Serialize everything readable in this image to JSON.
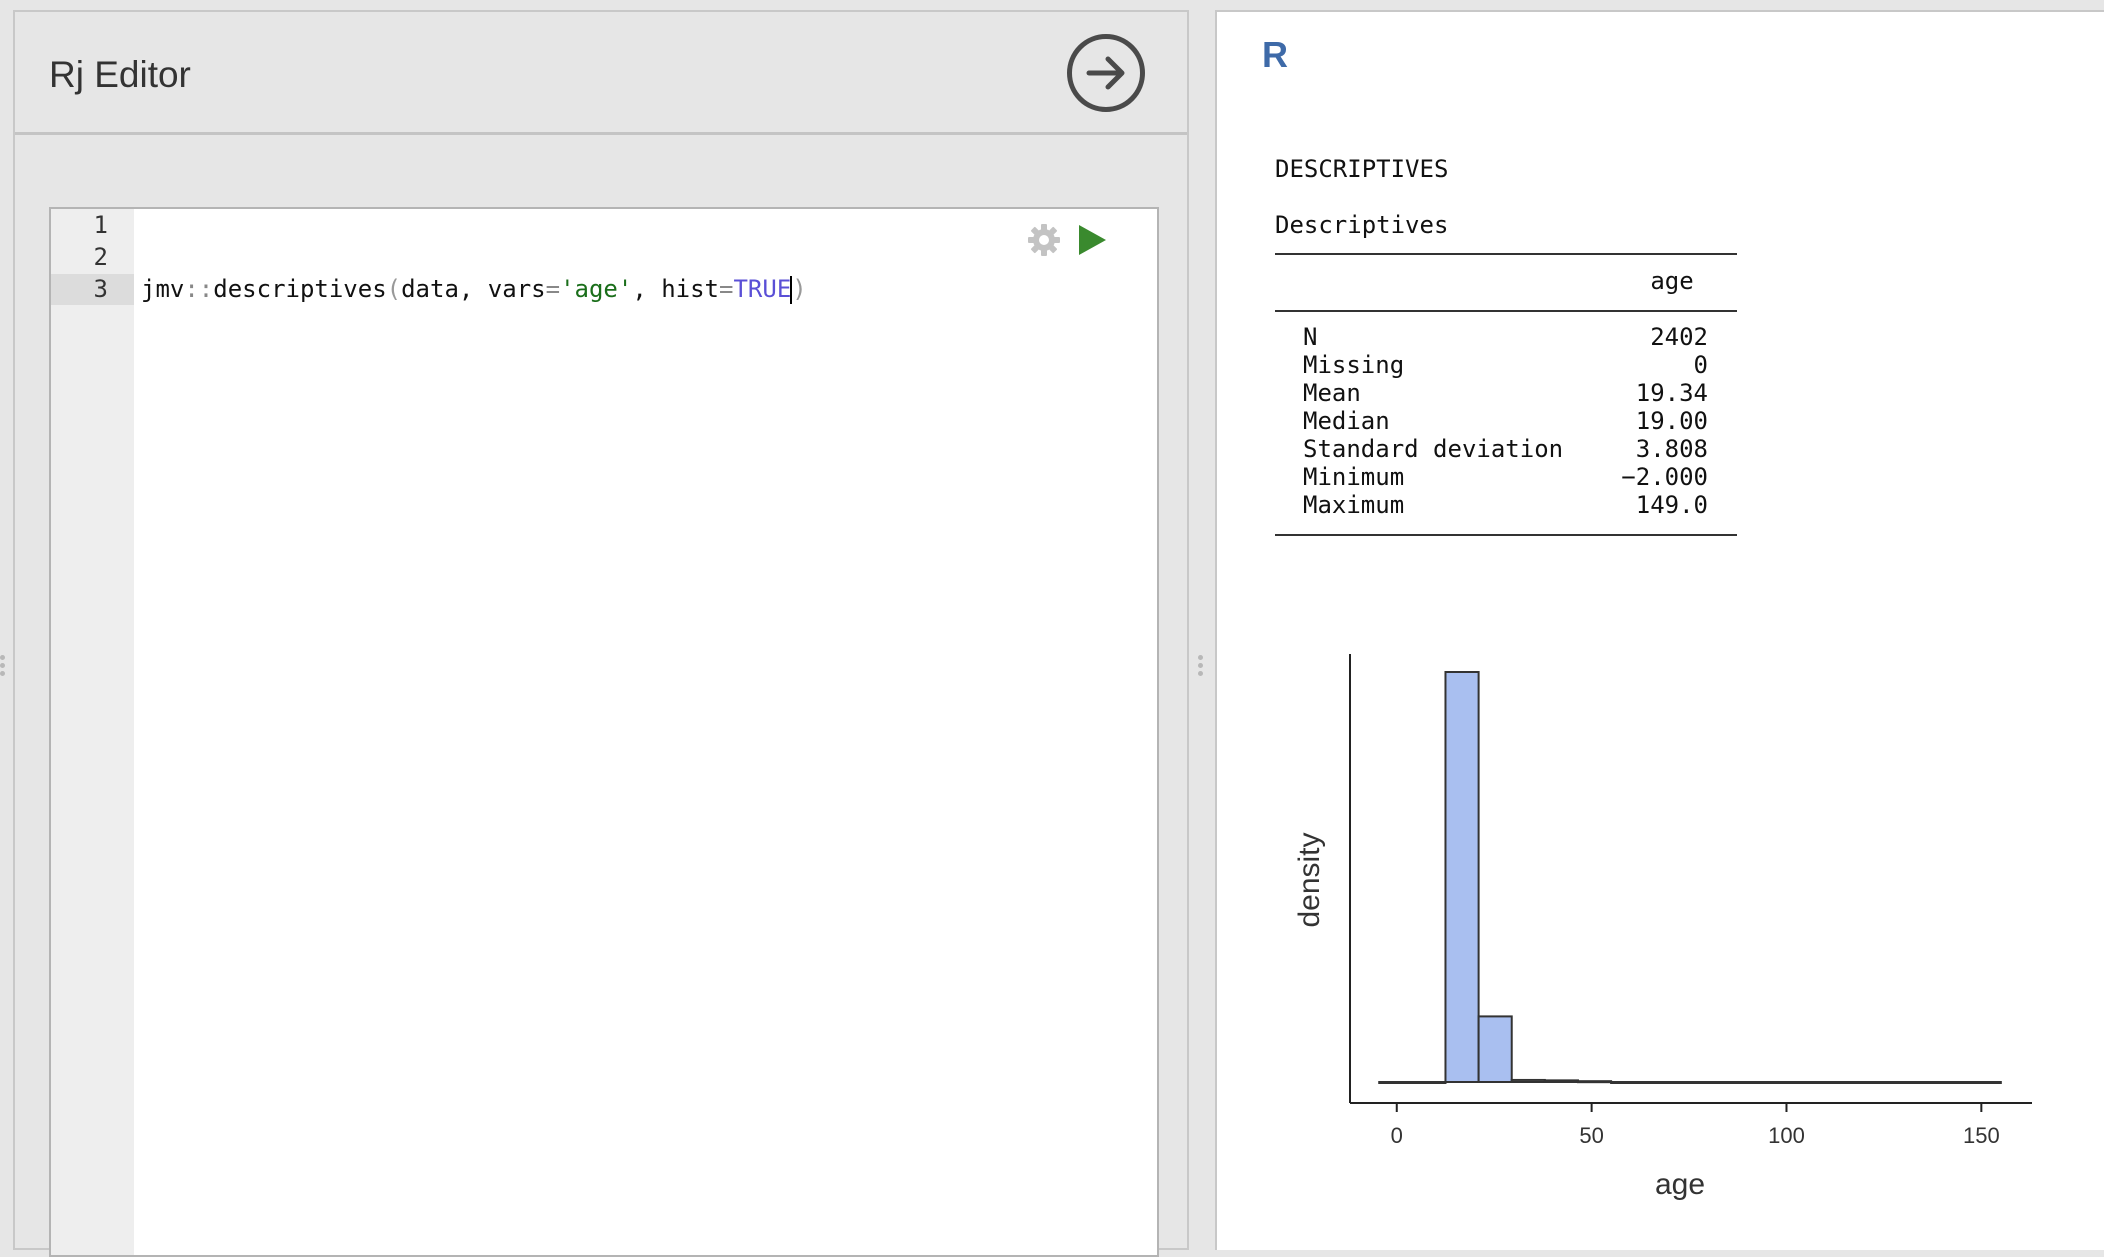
{
  "editor": {
    "title": "Rj Editor",
    "line_numbers": [
      "1",
      "2",
      "3"
    ],
    "code": {
      "fn_ns": "jmv",
      "ns_op": "::",
      "fn_name": "descriptives",
      "paren_open": "(",
      "arg1": "data, vars",
      "eq1": "=",
      "str_val": "'age'",
      "sep": ", hist",
      "eq2": "=",
      "bool_val": "TRUE",
      "paren_close": ")"
    }
  },
  "icons": {
    "go": "arrow-right-circle-icon",
    "settings": "gear-icon",
    "run": "play-icon"
  },
  "colors": {
    "r_title": "#3e6aa8",
    "bar_fill": "#a9bff0",
    "run_green": "#3a8a2e",
    "string_green": "#1a6e1a",
    "bool_purple": "#5a4fd6"
  },
  "results": {
    "title": "R",
    "section": "DESCRIPTIVES",
    "table_title": "Descriptives",
    "column": "age",
    "rows": [
      {
        "label": "N",
        "value": "2402"
      },
      {
        "label": "Missing",
        "value": "0"
      },
      {
        "label": "Mean",
        "value": "19.34"
      },
      {
        "label": "Median",
        "value": "19.00"
      },
      {
        "label": "Standard deviation",
        "value": "3.808"
      },
      {
        "label": "Minimum",
        "value": "−2.000"
      },
      {
        "label": "Maximum",
        "value": "149.0"
      }
    ]
  },
  "chart_data": {
    "type": "bar",
    "xlabel": "age",
    "ylabel": "density",
    "xticks": [
      "0",
      "50",
      "100",
      "150"
    ],
    "xlim": [
      -12,
      163
    ],
    "bins": [
      {
        "x0": -4.5,
        "x1": 12.5,
        "density": 0.0
      },
      {
        "x0": 12.5,
        "x1": 21,
        "density": 1.0
      },
      {
        "x0": 21,
        "x1": 29.5,
        "density": 0.16
      },
      {
        "x0": 29.5,
        "x1": 38,
        "density": 0.005
      },
      {
        "x0": 38,
        "x1": 46.5,
        "density": 0.004
      },
      {
        "x0": 46.5,
        "x1": 55,
        "density": 0.002
      },
      {
        "x0": 55,
        "x1": 155,
        "density": 0.0
      }
    ]
  }
}
